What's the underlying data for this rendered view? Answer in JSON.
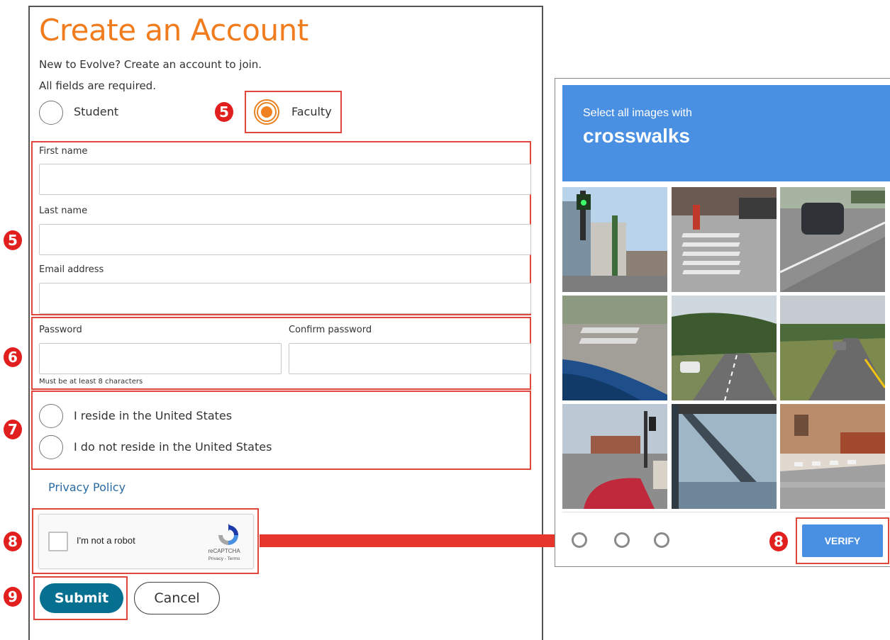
{
  "form": {
    "title": "Create an Account",
    "intro": "New to Evolve? Create an account to join.",
    "required_note": "All fields are required.",
    "role_options": [
      {
        "label": "Student",
        "selected": false
      },
      {
        "label": "Faculty",
        "selected": true
      }
    ],
    "fields": {
      "first_name": {
        "label": "First name",
        "value": ""
      },
      "last_name": {
        "label": "Last name",
        "value": ""
      },
      "email": {
        "label": "Email address",
        "value": ""
      },
      "password": {
        "label": "Password",
        "value": "",
        "hint": "Must be at least 8 characters"
      },
      "confirm_password": {
        "label": "Confirm password",
        "value": ""
      }
    },
    "residency_options": [
      {
        "label": "I reside in the United States",
        "selected": false
      },
      {
        "label": "I do not reside in the United States",
        "selected": false
      }
    ],
    "privacy_link": "Privacy Policy",
    "recaptcha": {
      "label": "I'm not a robot",
      "brand": "reCAPTCHA",
      "terms": "Privacy - Terms",
      "checked": false
    },
    "submit_label": "Submit",
    "cancel_label": "Cancel"
  },
  "steps": {
    "role": "5",
    "name_fields": "5",
    "password_fields": "6",
    "residency": "7",
    "recaptcha": "8",
    "verify": "8",
    "submit": "9"
  },
  "captcha_challenge": {
    "instruction": "Select all images with",
    "keyword": "crosswalks",
    "grid_rows": 3,
    "grid_cols": 3,
    "verify_label": "VERIFY"
  },
  "colors": {
    "title_orange": "#f07c1e",
    "radio_orange": "#f08020",
    "submit_teal": "#05708f",
    "link_blue": "#2a6aa3",
    "annotation_red": "#e0463a",
    "captcha_blue": "#4a90e2"
  }
}
